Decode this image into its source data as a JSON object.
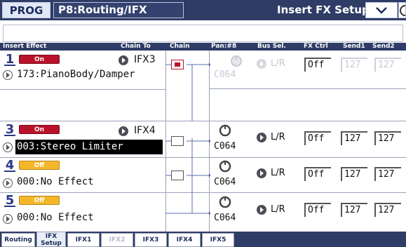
{
  "title_bar": {
    "mode": "PROG",
    "page": "P8:Routing/IFX",
    "subpage": "Insert FX Setup",
    "menu_icon": "chevron-down-icon"
  },
  "columns": {
    "insert_effect": "Insert Effect",
    "chain_to": "Chain To",
    "chain": "Chain",
    "pan": "Pan:#8",
    "bus_sel": "Bus Sel.",
    "fx_ctrl": "FX Ctrl",
    "send1": "Send1",
    "send2": "Send2"
  },
  "slots": [
    {
      "num": "1",
      "state": "On",
      "chain_to": "IFX3",
      "effect": "173:PianoBody/Damper",
      "pan": "C064",
      "bus": "L/R",
      "fx_ctrl": "Off",
      "send1": "127",
      "send2": "127"
    },
    {
      "num": "3",
      "state": "On",
      "chain_to": "IFX4",
      "effect": "003:Stereo Limiter",
      "pan": "C064",
      "bus": "L/R",
      "fx_ctrl": "Off",
      "send1": "127",
      "send2": "127"
    },
    {
      "num": "4",
      "state": "Off",
      "effect": "000:No Effect",
      "pan": "C064",
      "bus": "L/R",
      "fx_ctrl": "Off",
      "send1": "127",
      "send2": "127"
    },
    {
      "num": "5",
      "state": "Off",
      "effect": "000:No Effect",
      "pan": "C064",
      "bus": "L/R",
      "fx_ctrl": "Off",
      "send1": "127",
      "send2": "127"
    }
  ],
  "tabs": [
    {
      "label": "Routing"
    },
    {
      "label": "IFX",
      "label2": "Setup"
    },
    {
      "label": "IFX1"
    },
    {
      "label": "IFX2"
    },
    {
      "label": "IFX3"
    },
    {
      "label": "IFX4"
    },
    {
      "label": "IFX5"
    }
  ]
}
